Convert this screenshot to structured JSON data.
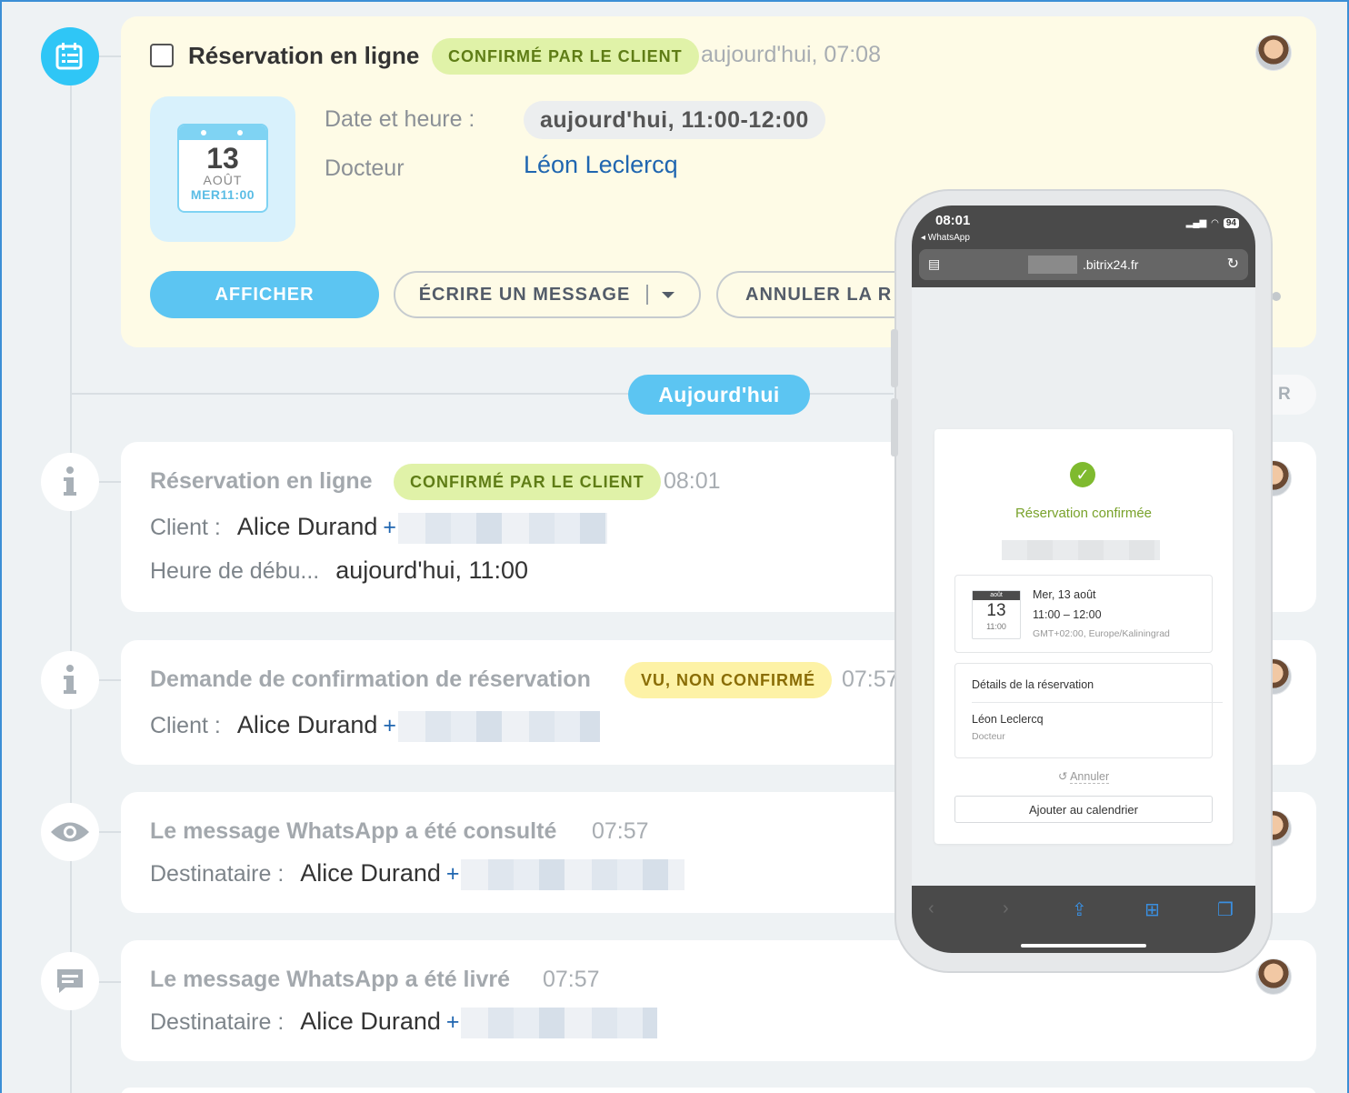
{
  "main_activity": {
    "title": "Réservation en ligne",
    "status": "CONFIRMÉ PAR LE CLIENT",
    "time": "aujourd'hui, 07:08",
    "calendar": {
      "day": "13",
      "month": "AOÛT",
      "weekday": "MER",
      "time": "11:00"
    },
    "date_label": "Date et heure :",
    "date_value": "aujourd'hui, 11:00-12:00",
    "doctor_label": "Docteur",
    "doctor_value": "Léon Leclercq",
    "buttons": {
      "view": "AFFICHER",
      "write": "ÉCRIRE UN MESSAGE",
      "cancel": "ANNULER LA R"
    }
  },
  "divider": {
    "label": "Aujourd'hui",
    "right_label": "R"
  },
  "events": [
    {
      "title": "Réservation en ligne",
      "badge": "CONFIRMÉ PAR LE CLIENT",
      "time": "08:01",
      "line1_label": "Client :",
      "line1_value": "Alice Durand",
      "line2_label": "Heure de débu...",
      "line2_value": "aujourd'hui, 11:00"
    },
    {
      "title": "Demande de confirmation de réservation",
      "badge": "VU, NON CONFIRMÉ",
      "time": "07:57",
      "line1_label": "Client :",
      "line1_value": "Alice Durand"
    },
    {
      "title": "Le message WhatsApp a été consulté",
      "time": "07:57",
      "line1_label": "Destinataire :",
      "line1_value": "Alice Durand"
    },
    {
      "title": "Le message WhatsApp a été livré",
      "time": "07:57",
      "line1_label": "Destinataire :",
      "line1_value": "Alice Durand"
    }
  ],
  "plus": "+",
  "phone": {
    "status_time": "08:01",
    "back_app": "◂ WhatsApp",
    "battery": "94",
    "url": ".bitrix24.fr",
    "confirmed": "Réservation confirmée",
    "cal_month": "août",
    "cal_day": "13",
    "cal_time": "11:00",
    "date_line": "Mer, 13 août",
    "time_line": "11:00 – 12:00",
    "timezone": "GMT+02:00, Europe/Kaliningrad",
    "details_title": "Détails de la réservation",
    "doctor": "Léon Leclercq",
    "doctor_role": "Docteur",
    "cancel": "Annuler",
    "add_calendar": "Ajouter au calendrier"
  }
}
